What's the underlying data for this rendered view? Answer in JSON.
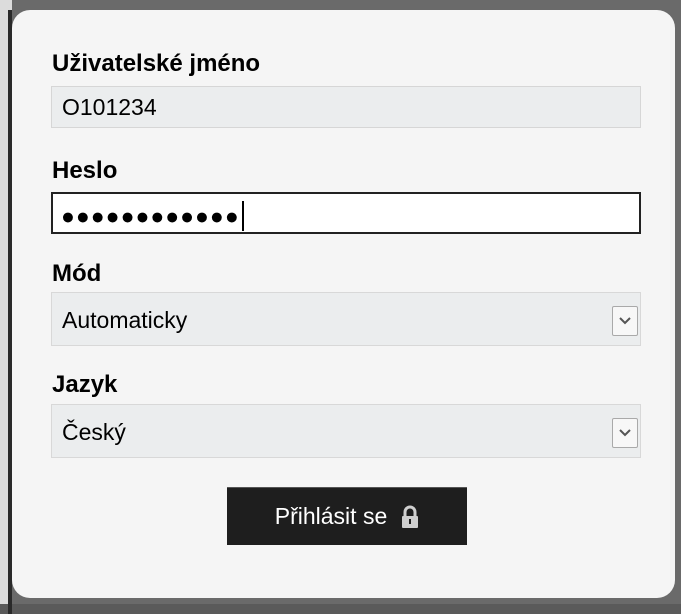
{
  "login": {
    "username": {
      "label": "Uživatelské jméno",
      "value": "O101234"
    },
    "password": {
      "label": "Heslo",
      "masked_value": "●●●●●●●●●●●●"
    },
    "mode": {
      "label": "Mód",
      "selected": "Automaticky"
    },
    "language": {
      "label": "Jazyk",
      "selected": "Český"
    },
    "submit_label": "Přihlásit se",
    "submit_icon": "padlock-icon"
  },
  "colors": {
    "button_bg": "#1e1e1e",
    "field_bg": "#ebedee",
    "panel_bg": "#f5f5f5"
  }
}
